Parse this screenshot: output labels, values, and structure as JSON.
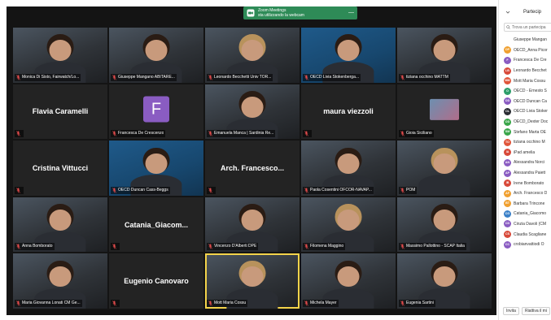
{
  "notification": {
    "title": "Zoom Meetings",
    "message": "sta utilizzando la webcam",
    "close": "—",
    "color": "#2e8b57"
  },
  "participants_panel": {
    "title": "Partecip",
    "search_placeholder": "Trova un partecipa",
    "items": [
      {
        "initials": "",
        "name": "Giuseppe Mangan",
        "color": ""
      },
      {
        "initials": "OP",
        "name": "OECD_Anna Picor",
        "color": "#f0a030"
      },
      {
        "initials": "F",
        "name": "Francesca De Cre",
        "color": "#8a5cc2"
      },
      {
        "initials": "LB",
        "name": "Leonardo Becchet",
        "color": "#d84a3a"
      },
      {
        "initials": "MM",
        "name": "Mott Maria Cossu",
        "color": "#e0553a"
      },
      {
        "initials": "O",
        "name": "OECD - Ernesto S",
        "color": "#2e9e6b"
      },
      {
        "initials": "OD",
        "name": "OECD Duncan Ca",
        "color": "#8a5cc2"
      },
      {
        "initials": "OL",
        "name": "OECD Livia Stoker",
        "color": "#2a2d33"
      },
      {
        "initials": "OD",
        "name": "OECD_Dexter Doc",
        "color": "#3aa64a"
      },
      {
        "initials": "SM",
        "name": "Stefano Marta OE",
        "color": "#3aa64a"
      },
      {
        "initials": "TO",
        "name": "tiziana occhino M",
        "color": "#e0553a"
      },
      {
        "initials": "IA",
        "name": "iPad amelia",
        "color": "#d84a3a"
      },
      {
        "initials": "AN",
        "name": "Alessandra Norci",
        "color": "#8a5cc2"
      },
      {
        "initials": "AP",
        "name": "Alessandra Paiett",
        "color": "#8a5cc2"
      },
      {
        "initials": "IB",
        "name": "Irene Bomborato",
        "color": "#d84a3a"
      },
      {
        "initials": "AF",
        "name": "Arch. Francesco D",
        "color": "#f0a030"
      },
      {
        "initials": "BT",
        "name": "Barbara Trincone",
        "color": "#f0a030"
      },
      {
        "initials": "CG",
        "name": "Catania_Giacomo",
        "color": "#3a80c8"
      },
      {
        "initials": "CD",
        "name": "Cinzia Davoli (CM",
        "color": "#8a5cc2"
      },
      {
        "initials": "CS",
        "name": "Claudia Scagliane",
        "color": "#d84a3a"
      },
      {
        "initials": "CC",
        "name": "crobianvattiodi O",
        "color": "#8a5cc2"
      }
    ],
    "footer_buttons": [
      "Invita",
      "Riattiva il mi"
    ]
  },
  "tiles": [
    {
      "style": "video",
      "label": "Monica Di Sisto, Fairwatch/Lo..."
    },
    {
      "style": "video",
      "label": "Giuseppe Mangano ABITARE..."
    },
    {
      "style": "video",
      "label": "Leonardo Becchetti Univ TOR..."
    },
    {
      "style": "oecd",
      "label": "OECD Livia Stokenberga..."
    },
    {
      "style": "video",
      "label": "tiziana occhino MATTM"
    },
    {
      "style": "name",
      "center": "Flavia Caramelli",
      "label": ""
    },
    {
      "style": "avatar",
      "avatar": "F",
      "label": "Francesca De Crescenzo"
    },
    {
      "style": "video",
      "label": "Emanuela Manca | Sardinia Re..."
    },
    {
      "style": "name",
      "center": "maura viezzoli",
      "label": ""
    },
    {
      "style": "photo",
      "label": "Gioia Siciliano"
    },
    {
      "style": "name",
      "center": "Cristina Vittucci",
      "label": ""
    },
    {
      "style": "oecd",
      "label": "OECD Duncan Cass-Beggs"
    },
    {
      "style": "name",
      "center": "Arch. Francesco...",
      "label": ""
    },
    {
      "style": "video",
      "label": "Paola Cosentini OFCOR-NAVAP..."
    },
    {
      "style": "video",
      "label": "POM"
    },
    {
      "style": "video",
      "label": "Anna Bomborato"
    },
    {
      "style": "name",
      "center": "Catania_Giacom...",
      "label": ""
    },
    {
      "style": "video",
      "label": "Vincenzo D'Alberti DPE"
    },
    {
      "style": "video",
      "label": "Filomena Maggino"
    },
    {
      "style": "video",
      "label": "Massimo Pallottino - SCAP Italia"
    },
    {
      "style": "video",
      "label": "Maria Giovanna Lonati CM Ge..."
    },
    {
      "style": "name",
      "center": "Eugenio Canovaro",
      "label": ""
    },
    {
      "style": "active",
      "label": "Mott Maria Cossu"
    },
    {
      "style": "video",
      "label": "Michela Mayer"
    },
    {
      "style": "video",
      "label": "Eugenia Sartini"
    }
  ]
}
